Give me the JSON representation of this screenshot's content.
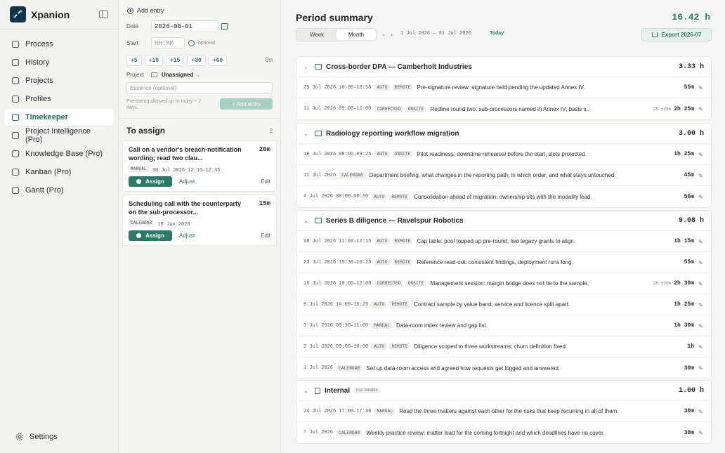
{
  "brand": "Xpanion",
  "nav": [
    "Process",
    "History",
    "Projects",
    "Profiles",
    "Timekeeper",
    "Project Intelligence (Pro)",
    "Knowledge Base (Pro)",
    "Kanban (Pro)",
    "Gantt (Pro)"
  ],
  "settings": "Settings",
  "add": {
    "title": "Add entry",
    "date_label": "Date",
    "date_value": "2026-08-01",
    "start_label": "Start",
    "start_placeholder": "HH:MM",
    "optional": "optional",
    "chips": [
      "+5",
      "+10",
      "+15",
      "+30",
      "+60"
    ],
    "elapsed": "0m",
    "project_label": "Project",
    "project_value": "Unassigned",
    "essence_placeholder": "Essence (optional)",
    "hint": "Pre-dating allowed up to today + 2 days.",
    "add_button": "+ Add entry"
  },
  "assign": {
    "title": "To assign",
    "count": "2",
    "cards": [
      {
        "title": "Call on a vendor's breach-notification wording; read two clau...",
        "duration": "20m",
        "tag": "MANUAL",
        "meta": "30 Jul 2026  12:15–12:35",
        "assign": "Assign",
        "adjust": "Adjust",
        "edit": "Edit"
      },
      {
        "title": "Scheduling call with the counterparty on the sub-processor...",
        "duration": "15m",
        "tag": "CALENDAR",
        "meta": "18 Jun 2026",
        "assign": "Assign",
        "adjust": "Adjust",
        "edit": "Edit"
      }
    ]
  },
  "summary": {
    "title": "Period summary",
    "total": "16.42 h",
    "tabs": [
      "Week",
      "Month"
    ],
    "range": "1 Jul 2026 — 31 Jul 2026",
    "today": "Today",
    "export": "Export 2026-07"
  },
  "groups": [
    {
      "title": "Cross-border DPA — Camberholt Industries",
      "total": "3.33 h",
      "entries": [
        {
          "date": "25 Jul 2026",
          "time": "16:00–16:55",
          "tags": [
            "AUTO",
            "REMOTE"
          ],
          "desc": "Pre-signature review: signature held pending the updated Annex IV.",
          "orig": "",
          "dur": "55m"
        },
        {
          "date": "11 Jul 2026",
          "time": "09:00–11:00",
          "tags": [
            "CORRECTED",
            "ONSITE"
          ],
          "desc": "Redline round two: sub-processors named in Annex IV; basis s...",
          "orig": "2h +25m",
          "dur": "2h 25m"
        }
      ]
    },
    {
      "title": "Radiology reporting workflow migration",
      "total": "3.00 h",
      "entries": [
        {
          "date": "18 Jul 2026",
          "time": "08:00–09:25",
          "tags": [
            "AUTO",
            "ONSITE"
          ],
          "desc": "Pilot readiness: downtime rehearsal before the start, slots protected.",
          "orig": "",
          "dur": "1h 25m"
        },
        {
          "date": "11 Jul 2026",
          "time": "",
          "tags": [
            "CALENDAR"
          ],
          "desc": "Department briefing: what changes in the reporting path, in which order, and what stays untouched.",
          "orig": "",
          "dur": "45m"
        },
        {
          "date": "4 Jul 2026",
          "time": "08:00–08:50",
          "tags": [
            "AUTO",
            "REMOTE"
          ],
          "desc": "Consolidation ahead of migration; ownership sits with the modality lead.",
          "orig": "",
          "dur": "50m"
        }
      ]
    },
    {
      "title": "Series B diligence — Ravelspur Robotics",
      "total": "9.08 h",
      "entries": [
        {
          "date": "28 Jul 2026",
          "time": "11:00–12:15",
          "tags": [
            "AUTO",
            "REMOTE"
          ],
          "desc": "Cap table: pool topped up pre-round; two legacy grants to align.",
          "orig": "",
          "dur": "1h 15m"
        },
        {
          "date": "23 Jul 2026",
          "time": "15:30–16:25",
          "tags": [
            "AUTO",
            "REMOTE"
          ],
          "desc": "Reference read-out: consistent findings, deployment runs long.",
          "orig": "",
          "dur": "55m"
        },
        {
          "date": "16 Jul 2026",
          "time": "10:00–12:00",
          "tags": [
            "CORRECTED",
            "ONSITE"
          ],
          "desc": "Management session: margin bridge does not tie to the sample.",
          "orig": "2h +30m",
          "dur": "2h 30m"
        },
        {
          "date": "9 Jul 2026",
          "time": "14:00–15:25",
          "tags": [
            "AUTO",
            "REMOTE"
          ],
          "desc": "Contract sample by value band; service and licence split apart.",
          "orig": "",
          "dur": "1h 25m"
        },
        {
          "date": "3 Jul 2026",
          "time": "09:30–11:00",
          "tags": [
            "MANUAL"
          ],
          "desc": "Data-room index review and gap list.",
          "orig": "",
          "dur": "1h 30m"
        },
        {
          "date": "2 Jul 2026",
          "time": "09:00–10:00",
          "tags": [
            "AUTO",
            "REMOTE"
          ],
          "desc": "Diligence scoped to three workstreams; churn definition fixed.",
          "orig": "",
          "dur": "1h"
        },
        {
          "date": "1 Jul 2026",
          "time": "",
          "tags": [
            "CALENDAR"
          ],
          "desc": "Set up data-room access and agreed how requests get logged and answered.",
          "orig": "",
          "dur": "30m"
        }
      ]
    },
    {
      "title": "Internal",
      "badge": "non-billable",
      "total": "1.00 h",
      "entries": [
        {
          "date": "24 Jul 2026",
          "time": "17:00–17:30",
          "tags": [
            "MANUAL"
          ],
          "desc": "Read the three matters against each other for the risks that keep recurring in all of them.",
          "orig": "",
          "dur": "30m"
        },
        {
          "date": "7 Jul 2026",
          "time": "",
          "tags": [
            "CALENDAR"
          ],
          "desc": "Weekly practice review: matter load for the coming fortnight and which deadlines have no cover.",
          "orig": "",
          "dur": "30m"
        }
      ]
    }
  ]
}
